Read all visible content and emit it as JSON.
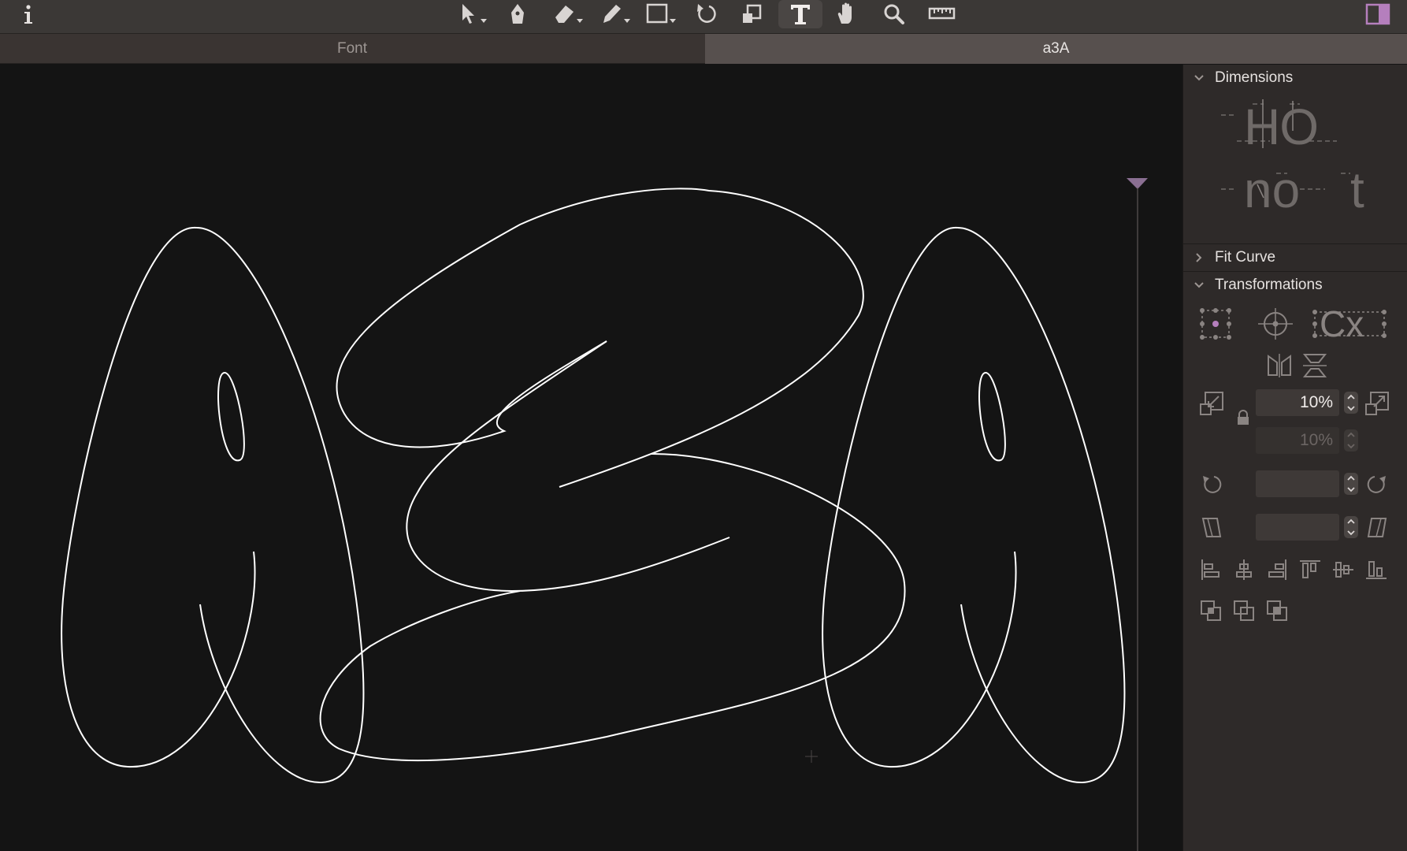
{
  "tabs": [
    {
      "label": "Font",
      "active": false
    },
    {
      "label": "a3A",
      "active": true
    }
  ],
  "toolbar": {
    "tools": [
      "info-icon",
      "select-tool-icon",
      "pen-tool-icon",
      "eraser-tool-icon",
      "pencil-tool-icon",
      "rectangle-tool-icon",
      "rotate-tool-icon",
      "scale-tool-icon",
      "text-tool-icon",
      "hand-tool-icon",
      "zoom-tool-icon",
      "measure-tool-icon",
      "sidebar-toggle-icon"
    ],
    "active_tool": "text-tool-icon"
  },
  "panel": {
    "dimensions": {
      "title": "Dimensions",
      "expanded": true,
      "preview_top": "HO",
      "preview_bottom_left": "no",
      "preview_bottom_right": "t"
    },
    "fit_curve": {
      "title": "Fit Curve",
      "expanded": false
    },
    "transformations": {
      "title": "Transformations",
      "expanded": true,
      "scale_x": "10%",
      "scale_y": "10%",
      "rotate_value": "",
      "slant_value": ""
    }
  },
  "colors": {
    "toolbar_bg": "#3b3836",
    "canvas_bg": "#141414",
    "panel_bg": "#2e2a29",
    "accent": "#9b6fa4",
    "outline": "#ffffff"
  }
}
